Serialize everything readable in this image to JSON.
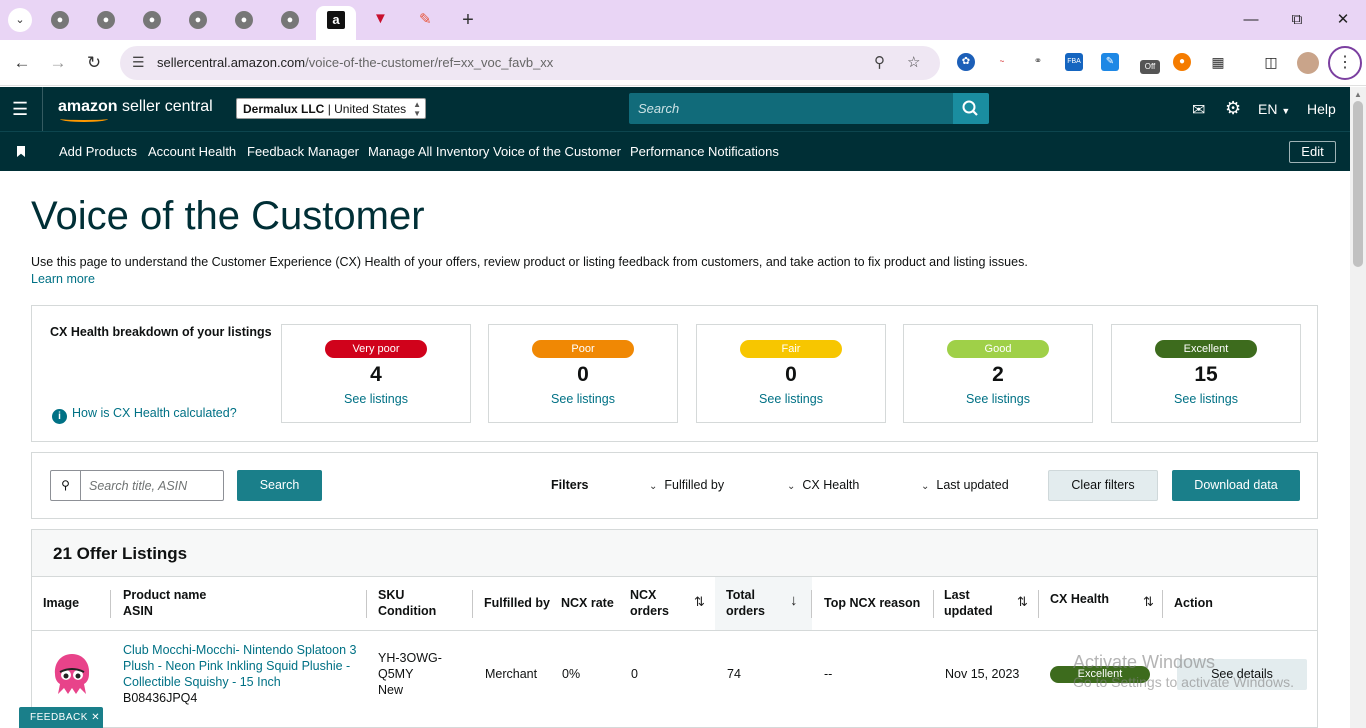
{
  "browser": {
    "url_host": "sellercentral.amazon.com",
    "url_path": "/voice-of-the-customer/ref=xx_voc_favb_xx",
    "ext_badge": "Off"
  },
  "header": {
    "logo_brand": "amazon",
    "logo_product": " seller central",
    "account_name": "Dermalux LLC",
    "account_region": " | United States",
    "search_placeholder": "Search",
    "language": "EN",
    "help": "Help"
  },
  "nav": {
    "links": [
      "Add Products",
      "Account Health",
      "Feedback Manager",
      "Manage All Inventory",
      "Voice of the Customer",
      "Performance Notifications"
    ],
    "edit": "Edit"
  },
  "page": {
    "title": "Voice of the Customer",
    "intro": "Use this page to understand the Customer Experience (CX) Health of your offers, review product or listing feedback from customers, and take action to fix product and listing issues.",
    "learn_more": "Learn more"
  },
  "cx": {
    "title": "CX Health breakdown of your listings",
    "how_link": "How is CX Health calculated?",
    "cards": [
      {
        "label": "Very poor",
        "count": "4",
        "link": "See listings",
        "color": "#d0021b"
      },
      {
        "label": "Poor",
        "count": "0",
        "link": "See listings",
        "color": "#f08804"
      },
      {
        "label": "Fair",
        "count": "0",
        "link": "See listings",
        "color": "#f7c600"
      },
      {
        "label": "Good",
        "count": "2",
        "link": "See listings",
        "color": "#9fd048"
      },
      {
        "label": "Excellent",
        "count": "15",
        "link": "See listings",
        "color": "#3d6b1d"
      }
    ]
  },
  "filters": {
    "search_placeholder": "Search title, ASIN",
    "search_button": "Search",
    "label": "Filters",
    "fulfilled_by": "Fulfilled by",
    "cx_health": "CX Health",
    "last_updated": "Last updated",
    "clear": "Clear filters",
    "download": "Download data"
  },
  "listings": {
    "title": "21 Offer Listings",
    "columns": {
      "image": "Image",
      "product_name": "Product name",
      "asin": "ASIN",
      "sku": "SKU",
      "condition": "Condition",
      "fulfilled_by": "Fulfilled by",
      "ncx_rate": "NCX rate",
      "ncx": "NCX",
      "ncx_orders": "orders",
      "total": "Total",
      "total_orders": "orders",
      "top_reason": "Top NCX reason",
      "last": "Last",
      "updated": "updated",
      "cx_health": "CX Health",
      "action": "Action"
    },
    "rows": [
      {
        "product_name": "Club Mocchi-Mocchi- Nintendo Splatoon 3 Plush - Neon Pink Inkling Squid Plushie - Collectible Squishy - 15 Inch",
        "asin": "B08436JPQ4",
        "sku_line1": "YH-3OWG-",
        "sku_line2": "Q5MY",
        "condition": "New",
        "fulfilled_by": "Merchant",
        "ncx_rate": "0%",
        "ncx_orders": "0",
        "total_orders": "74",
        "top_reason": "--",
        "last_updated": "Nov 15, 2023",
        "cx_health": "Excellent",
        "action": "See details"
      }
    ]
  },
  "watermark": {
    "line1": "Activate Windows",
    "line2": "Go to Settings to activate Windows."
  },
  "feedback": "FEEDBACK"
}
